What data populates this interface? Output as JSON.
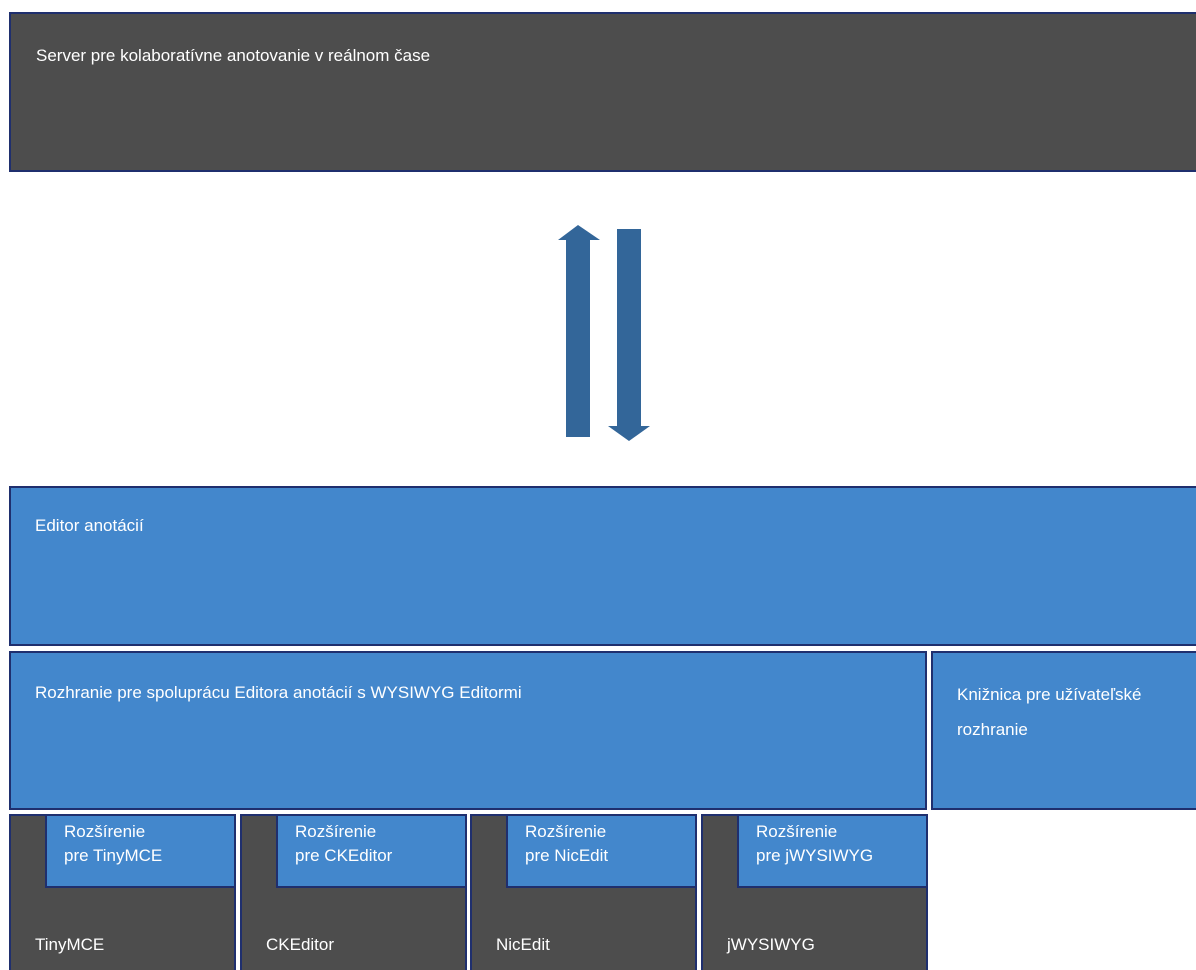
{
  "server": {
    "label": "Server pre kolaboratívne anotovanie v reálnom čase"
  },
  "editor": {
    "label": "Editor anotácií"
  },
  "interface": {
    "label": "Rozhranie pre spoluprácu Editora anotácií s WYSIWYG Editormi"
  },
  "ui_library": {
    "label": "Knižnica pre užívateľské rozhranie"
  },
  "editors": [
    {
      "name": "TinyMCE",
      "extension_line1": "Rozšírenie",
      "extension_line2": "pre TinyMCE"
    },
    {
      "name": "CKEditor",
      "extension_line1": "Rozšírenie",
      "extension_line2": "pre CKEditor"
    },
    {
      "name": "NicEdit",
      "extension_line1": "Rozšírenie",
      "extension_line2": "pre NicEdit"
    },
    {
      "name": "jWYSIWYG",
      "extension_line1": "Rozšírenie",
      "extension_line2": "pre jWYSIWYG"
    }
  ],
  "colors": {
    "dark_box": "#4d4d4d",
    "blue_box": "#4387cc",
    "border": "#1f2f6e",
    "arrow": "#336699",
    "text": "#ffffff"
  },
  "arrows": {
    "up_icon": "arrow-up-icon",
    "down_icon": "arrow-down-icon"
  }
}
